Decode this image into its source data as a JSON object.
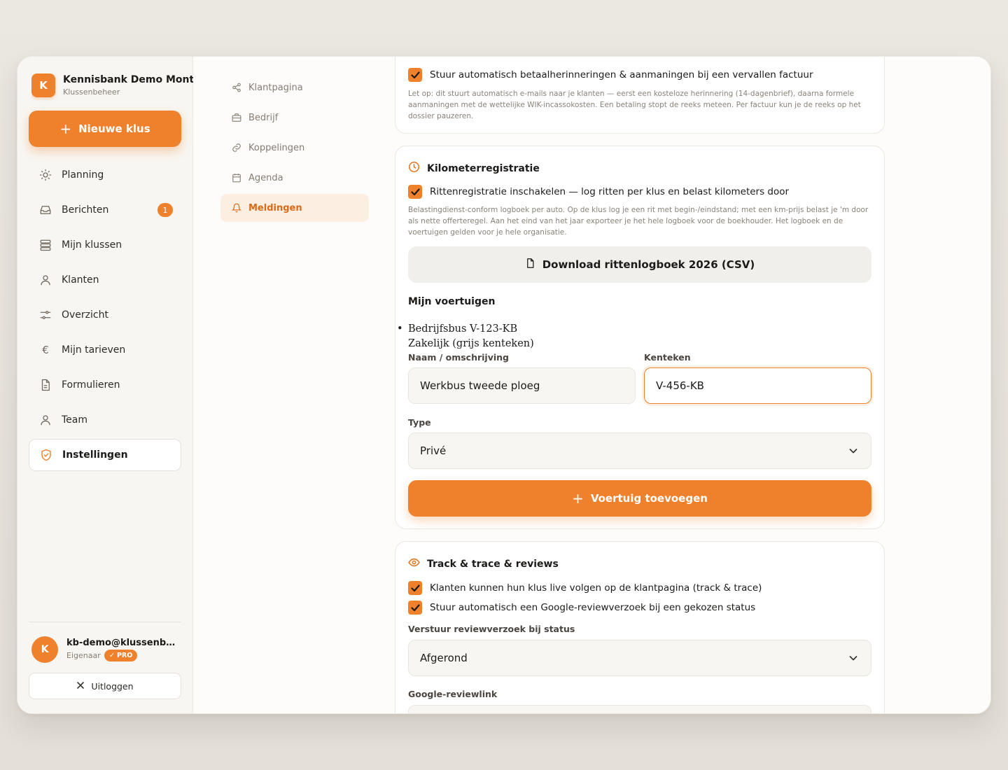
{
  "brand": {
    "logo_letter": "K",
    "name": "Kennisbank Demo Montage",
    "subtitle": "Klussenbeheer"
  },
  "new_job_button": "Nieuwe klus",
  "nav": {
    "items": [
      {
        "label": "Planning",
        "icon": "sun-icon"
      },
      {
        "label": "Berichten",
        "icon": "inbox-icon",
        "badge": "1"
      },
      {
        "label": "Mijn klussen",
        "icon": "stack-icon"
      },
      {
        "label": "Klanten",
        "icon": "person-icon"
      },
      {
        "label": "Overzicht",
        "icon": "sliders-icon"
      },
      {
        "label": "Mijn tarieven",
        "icon": "euro-icon"
      },
      {
        "label": "Formulieren",
        "icon": "document-icon"
      },
      {
        "label": "Team",
        "icon": "person-icon"
      },
      {
        "label": "Instellingen",
        "icon": "shield-icon",
        "active": true
      }
    ]
  },
  "user": {
    "avatar_letter": "K",
    "email": "kb-demo@klussenbeheer.nl",
    "role": "Eigenaar",
    "badge": "PRO"
  },
  "logout_label": "Uitloggen",
  "subnav": {
    "items": [
      {
        "label": "Klantpagina",
        "icon": "share-icon"
      },
      {
        "label": "Bedrijf",
        "icon": "briefcase-icon"
      },
      {
        "label": "Koppelingen",
        "icon": "link-icon"
      },
      {
        "label": "Agenda",
        "icon": "calendar-icon"
      },
      {
        "label": "Meldingen",
        "icon": "bell-icon",
        "active": true
      }
    ]
  },
  "payments": {
    "checkbox_label": "Stuur automatisch betaalherinneringen & aanmaningen bij een vervallen factuur",
    "checked": true,
    "help": "Let op: dit stuurt automatisch e-mails naar je klanten — eerst een kosteloze herinnering (14-dagenbrief), daarna formele aanmaningen met de wettelijke WIK-incassokosten. Een betaling stopt de reeks meteen. Per factuur kun je de reeks op het dossier pauzeren."
  },
  "mileage": {
    "title": "Kilometerregistratie",
    "checkbox_label": "Rittenregistratie inschakelen — log ritten per klus en belast kilometers door",
    "checked": true,
    "help": "Belastingdienst-conform logboek per auto. Op de klus log je een rit met begin-/eindstand; met een km-prijs belast je 'm door als nette offerteregel. Aan het eind van het jaar exporteer je het hele logboek voor de boekhouder. Het logboek en de voertuigen gelden voor je hele organisatie.",
    "download_label": "Download rittenlogboek 2026 (CSV)",
    "vehicles_title": "Mijn voertuigen",
    "vehicles": [
      {
        "name": "Bedrijfsbus V-123-KB",
        "type": "Zakelijk (grijs kenteken)"
      }
    ],
    "name_label": "Naam / omschrijving",
    "name_value": "Werkbus tweede ploeg",
    "plate_label": "Kenteken",
    "plate_value": "V-456-KB",
    "type_label": "Type",
    "type_value": "Privé",
    "add_label": "Voertuig toevoegen"
  },
  "track": {
    "title": "Track & trace & reviews",
    "checkbox1_label": "Klanten kunnen hun klus live volgen op de klantpagina (track & trace)",
    "checkbox2_label": "Stuur automatisch een Google-reviewverzoek bij een gekozen status",
    "status_label": "Verstuur reviewverzoek bij status",
    "status_value": "Afgerond",
    "review_link_label": "Google-reviewlink"
  },
  "colors": {
    "accent": "#f0812c",
    "accent_soft": "#fdeee2"
  }
}
